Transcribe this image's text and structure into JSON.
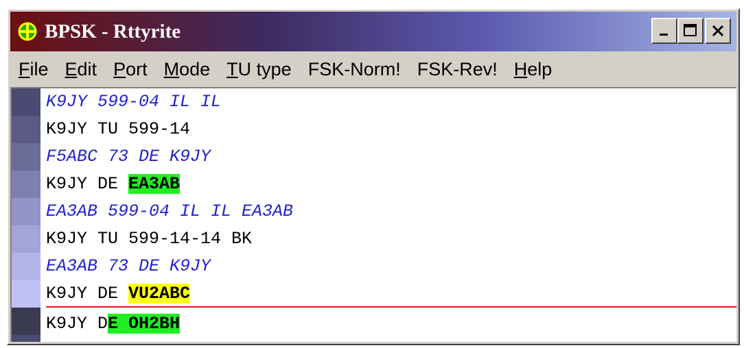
{
  "window": {
    "title": "BPSK - Rttyrite",
    "title_colors": {
      "start": "#6d0f10",
      "end": "#a4b4e4"
    }
  },
  "menu": {
    "items": [
      {
        "label": "File",
        "mnemonic": "F",
        "rest": "ile"
      },
      {
        "label": "Edit",
        "mnemonic": "E",
        "rest": "dit"
      },
      {
        "label": "Port",
        "mnemonic": "P",
        "rest": "ort"
      },
      {
        "label": "Mode",
        "mnemonic": "M",
        "rest": "ode"
      },
      {
        "label": "TU type",
        "mnemonic": "T",
        "rest": "U type"
      },
      {
        "label": "FSK-Norm!",
        "mnemonic": "",
        "rest": "FSK-Norm!"
      },
      {
        "label": "FSK-Rev!",
        "mnemonic": "",
        "rest": "FSK-Rev!"
      },
      {
        "label": "Help",
        "mnemonic": "H",
        "rest": "elp"
      }
    ]
  },
  "lines": [
    {
      "type": "rx",
      "pre": "K9JY 599-04 IL IL",
      "hl": "",
      "post": ""
    },
    {
      "type": "tx",
      "pre": "K9JY TU 599-14",
      "hl": "",
      "post": ""
    },
    {
      "type": "rx",
      "pre": "F5ABC 73 DE K9JY",
      "hl": "",
      "post": ""
    },
    {
      "type": "tx",
      "pre": "K9JY DE ",
      "hl": "EA3AB",
      "hl_color": "green",
      "post": ""
    },
    {
      "type": "rx",
      "pre": "EA3AB 599-04 IL IL EA3AB",
      "hl": "",
      "post": ""
    },
    {
      "type": "tx",
      "pre": "K9JY TU 599-14-14 BK",
      "hl": "",
      "post": ""
    },
    {
      "type": "rx",
      "pre": "EA3AB 73 DE K9JY",
      "hl": "",
      "post": ""
    },
    {
      "type": "tx",
      "pre": "K9JY DE ",
      "hl": "VU2ABC",
      "hl_color": "yellow",
      "post": ""
    },
    {
      "type": "tx",
      "pre": "K9JY D",
      "hl": "E OH2BH",
      "hl_color": "green",
      "post": ""
    }
  ],
  "colors": {
    "rx_text": "#2222cc",
    "highlight_green": "#22ee22",
    "highlight_yellow": "#ffff11",
    "divider": "#e01818"
  }
}
